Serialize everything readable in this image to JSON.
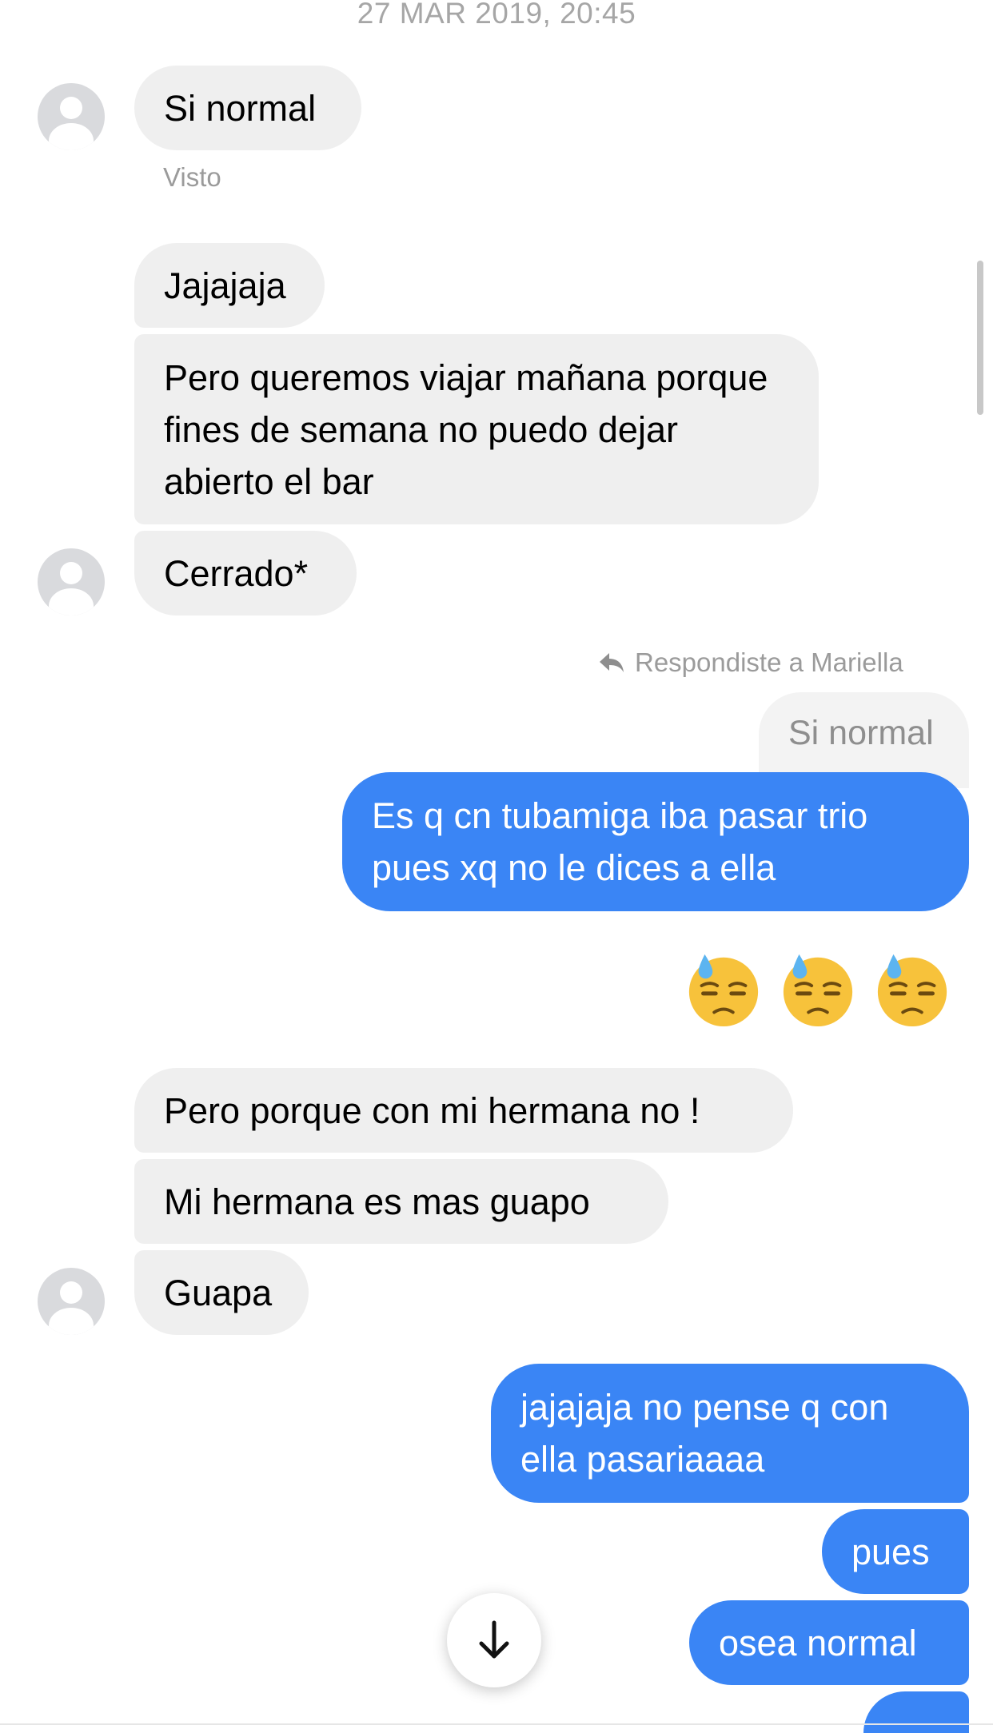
{
  "timestamp": "27 MAR 2019, 20:45",
  "messages": {
    "m1": "Si normal",
    "seen": "Visto",
    "m2": "Jajajaja",
    "m3": "Pero queremos viajar mañana porque fines de semana no puedo dejar abierto el bar",
    "m4": "Cerrado*",
    "reply_label": "Respondiste a Mariella",
    "reply_quote": "Si normal",
    "m5": "Es q cn tubamiga iba pasar trio pues xq no le dices a ella",
    "m6_emoji": "😓 😓 😓",
    "m7": "Pero porque con mi hermana no !",
    "m8": "Mi hermana es mas guapo",
    "m9": "Guapa",
    "m10": "jajajaja no pense q con ella pasariaaaa",
    "m11": "pues",
    "m12": "osea normal"
  },
  "colors": {
    "incoming_bubble": "#efefef",
    "outgoing_bubble": "#3a85f5",
    "meta_text": "#9b9b9b"
  },
  "icons": {
    "avatar": "default-avatar-icon",
    "reply": "reply-arrow-icon",
    "emoji": "downcast-face-with-sweat-icon",
    "scroll": "arrow-down-icon"
  }
}
